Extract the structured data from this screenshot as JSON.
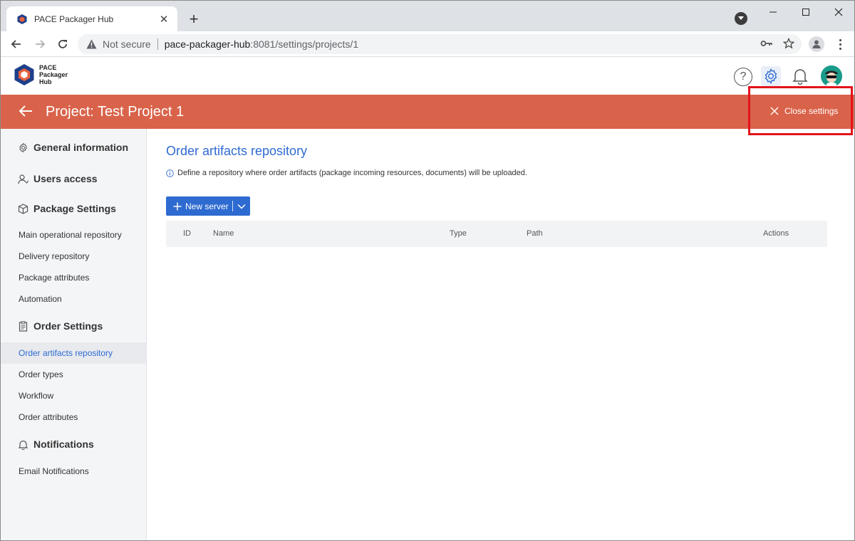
{
  "browser": {
    "tab_title": "PACE Packager Hub",
    "security_label": "Not secure",
    "url_host": "pace-packager-hub",
    "url_path": ":8081/settings/projects/1"
  },
  "app": {
    "logo_line1": "PACE",
    "logo_line2": "Packager",
    "logo_line3": "Hub",
    "help_label": "?"
  },
  "project_bar": {
    "title": "Project: Test Project 1",
    "close_label": "Close settings"
  },
  "sidebar": {
    "sections": {
      "general": "General information",
      "users": "Users access",
      "package": "Package Settings",
      "order": "Order Settings",
      "notifications": "Notifications"
    },
    "package_items": [
      "Main operational repository",
      "Delivery repository",
      "Package attributes",
      "Automation"
    ],
    "order_items": [
      "Order artifacts repository",
      "Order types",
      "Workflow",
      "Order attributes"
    ],
    "notification_items": [
      "Email Notifications"
    ]
  },
  "main": {
    "title": "Order artifacts repository",
    "description": "Define a repository where order artifacts (package incoming resources, documents) will be uploaded.",
    "new_server_label": "New server",
    "columns": [
      "ID",
      "Name",
      "Type",
      "Path",
      "Actions"
    ]
  },
  "colors": {
    "accent": "#2e6bd1",
    "project_bar": "#d9634a",
    "highlight": "#e3131b"
  }
}
